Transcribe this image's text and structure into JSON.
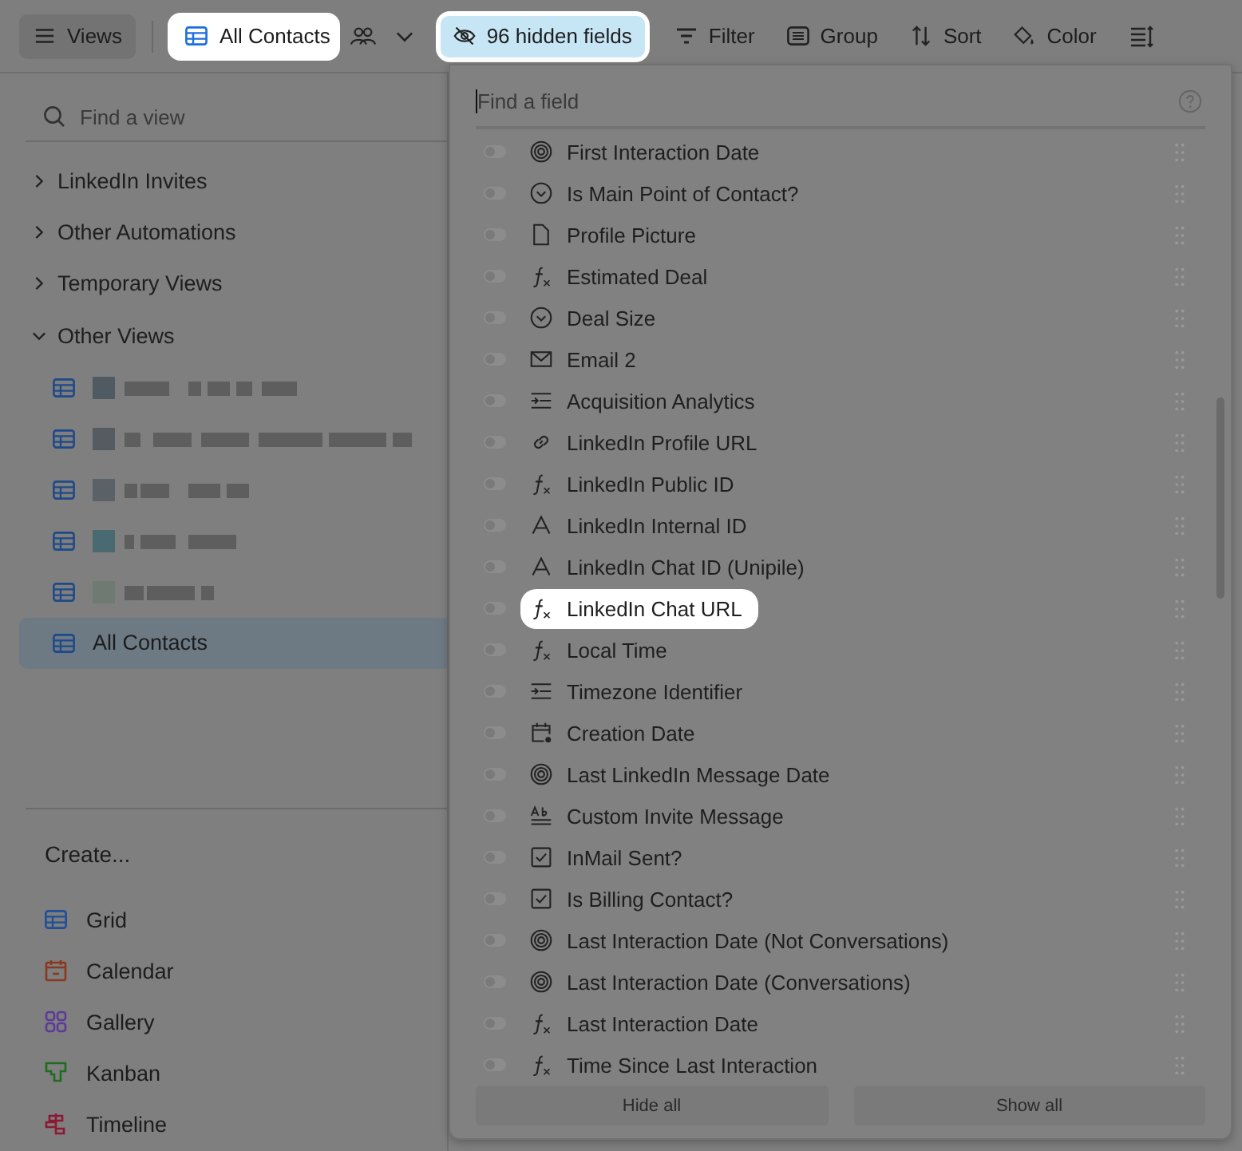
{
  "toolbar": {
    "views_button": {
      "label": "Views"
    },
    "view_button": {
      "label": "All Contacts",
      "highlighted": true
    },
    "hidden_fields_button": {
      "label": "96 hidden fields",
      "highlighted": true
    },
    "tools": [
      {
        "label": "Filter",
        "kind": "filter"
      },
      {
        "label": "Group",
        "kind": "group"
      },
      {
        "label": "Sort",
        "kind": "sort"
      },
      {
        "label": "Color",
        "kind": "color"
      }
    ]
  },
  "sidebar": {
    "search": {
      "placeholder": "Find a view"
    },
    "sections": [
      {
        "label": "LinkedIn Invites",
        "expanded": false
      },
      {
        "label": "Other Automations",
        "expanded": false
      },
      {
        "label": "Temporary Views",
        "expanded": false
      },
      {
        "label": "Other Views",
        "expanded": true
      }
    ],
    "views": [
      {
        "kind": "redacted",
        "selected": false
      },
      {
        "kind": "redacted",
        "selected": false
      },
      {
        "kind": "redacted",
        "selected": false
      },
      {
        "kind": "redacted",
        "selected": false
      },
      {
        "kind": "redacted",
        "selected": false
      },
      {
        "kind": "view",
        "label": "All Contacts",
        "selected": true
      }
    ],
    "create_title": "Create...",
    "create_items": [
      {
        "label": "Grid",
        "kind": "grid"
      },
      {
        "label": "Calendar",
        "kind": "calendar"
      },
      {
        "label": "Gallery",
        "kind": "gallery"
      },
      {
        "label": "Kanban",
        "kind": "kanban"
      },
      {
        "label": "Timeline",
        "kind": "timeline"
      }
    ]
  },
  "fields_popup": {
    "search": {
      "placeholder": "Find a field"
    },
    "fields": [
      {
        "name": "First Interaction Date",
        "kind": "target",
        "on": false,
        "highlighted": false
      },
      {
        "name": "Is Main Point of Contact?",
        "kind": "select",
        "on": false,
        "highlighted": false
      },
      {
        "name": "Profile Picture",
        "kind": "attachment",
        "on": false,
        "highlighted": false
      },
      {
        "name": "Estimated Deal",
        "kind": "formula",
        "on": false,
        "highlighted": false
      },
      {
        "name": "Deal Size",
        "kind": "select",
        "on": false,
        "highlighted": false
      },
      {
        "name": "Email 2",
        "kind": "email",
        "on": false,
        "highlighted": false
      },
      {
        "name": "Acquisition Analytics",
        "kind": "lookup",
        "on": false,
        "highlighted": false
      },
      {
        "name": "LinkedIn Profile URL",
        "kind": "link",
        "on": false,
        "highlighted": false
      },
      {
        "name": "LinkedIn Public ID",
        "kind": "formula",
        "on": false,
        "highlighted": false
      },
      {
        "name": "LinkedIn Internal ID",
        "kind": "text",
        "on": false,
        "highlighted": false
      },
      {
        "name": "LinkedIn Chat ID (Unipile)",
        "kind": "text",
        "on": false,
        "highlighted": false
      },
      {
        "name": "LinkedIn Chat URL",
        "kind": "formula",
        "on": false,
        "highlighted": true
      },
      {
        "name": "Local Time",
        "kind": "formula",
        "on": false,
        "highlighted": false
      },
      {
        "name": "Timezone Identifier",
        "kind": "lookup",
        "on": false,
        "highlighted": false
      },
      {
        "name": "Creation Date",
        "kind": "created",
        "on": false,
        "highlighted": false
      },
      {
        "name": "Last LinkedIn Message Date",
        "kind": "target",
        "on": false,
        "highlighted": false
      },
      {
        "name": "Custom Invite Message",
        "kind": "richtext",
        "on": false,
        "highlighted": false
      },
      {
        "name": "InMail Sent?",
        "kind": "checkbox",
        "on": false,
        "highlighted": false
      },
      {
        "name": "Is Billing Contact?",
        "kind": "checkbox",
        "on": false,
        "highlighted": false
      },
      {
        "name": "Last Interaction Date (Not Conversations)",
        "kind": "target",
        "on": false,
        "highlighted": false
      },
      {
        "name": "Last Interaction Date (Conversations)",
        "kind": "target",
        "on": false,
        "highlighted": false
      },
      {
        "name": "Last Interaction Date",
        "kind": "formula",
        "on": false,
        "highlighted": false
      },
      {
        "name": "Time Since Last Interaction",
        "kind": "formula",
        "on": false,
        "highlighted": false
      }
    ],
    "buttons": [
      {
        "label": "Hide all"
      },
      {
        "label": "Show all"
      }
    ]
  }
}
